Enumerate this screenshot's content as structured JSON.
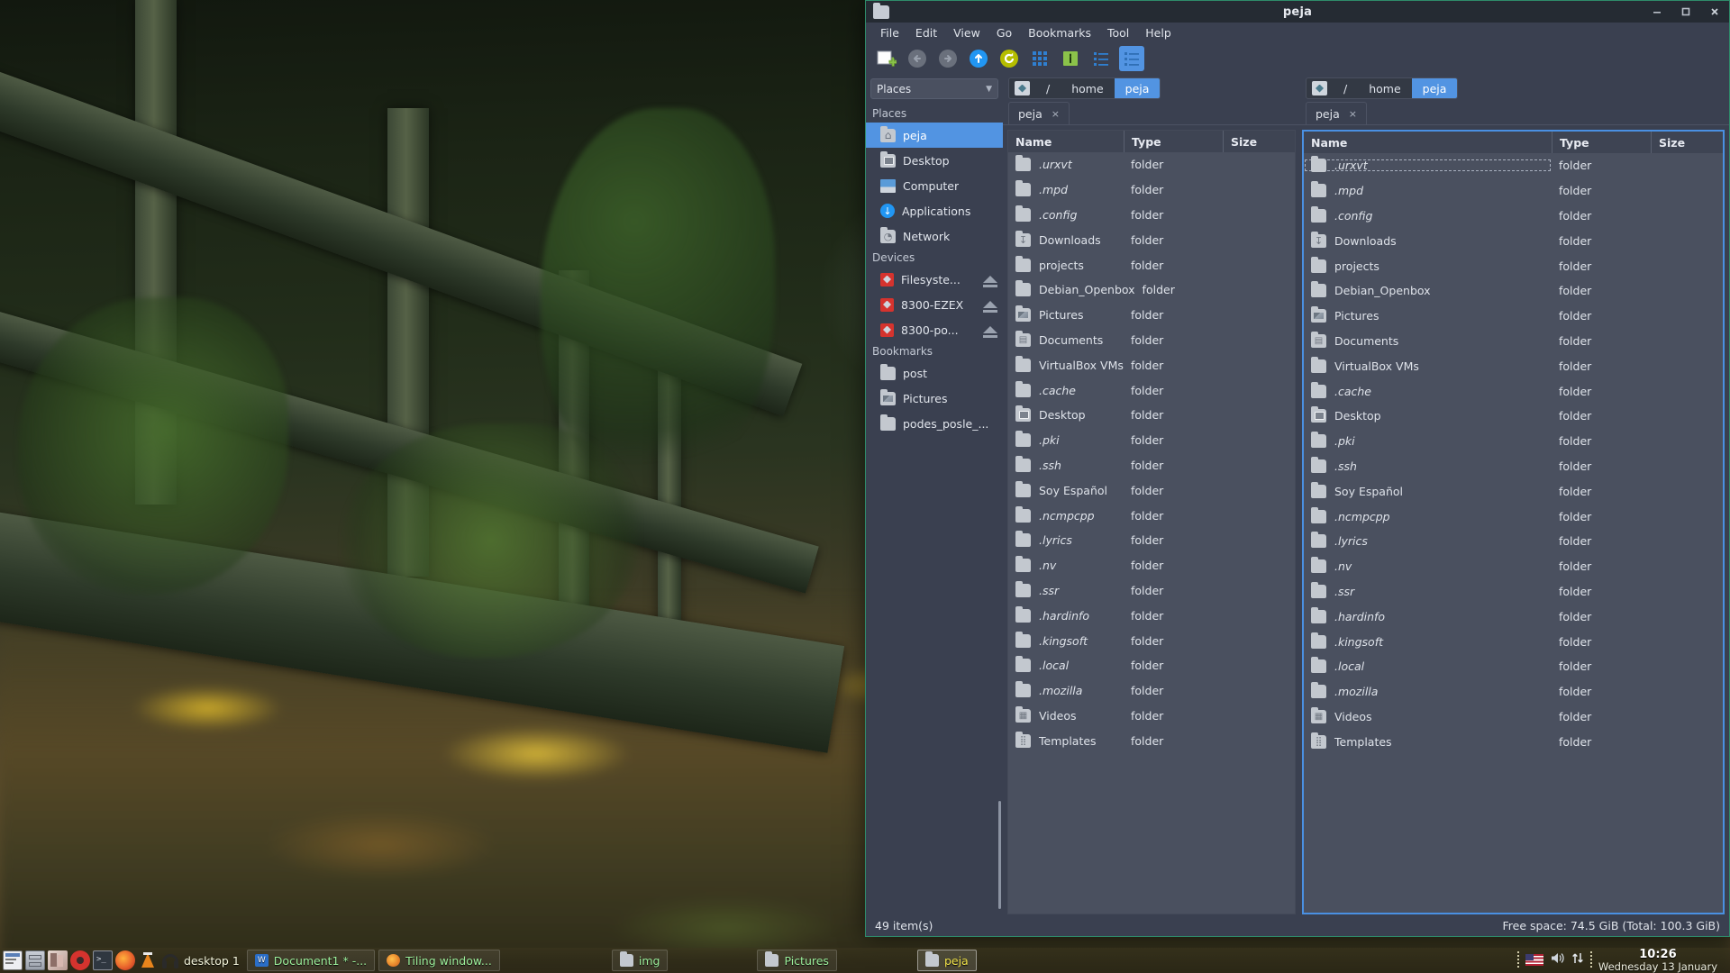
{
  "window": {
    "title": "peja",
    "controls": {
      "minimize": "minimize",
      "maximize": "maximize",
      "close": "close"
    }
  },
  "menubar": [
    "File",
    "Edit",
    "View",
    "Go",
    "Bookmarks",
    "Tool",
    "Help"
  ],
  "toolbar": [
    {
      "name": "new-tab-icon",
      "label": "New Tab"
    },
    {
      "name": "back-icon",
      "label": "Back"
    },
    {
      "name": "forward-icon",
      "label": "Forward"
    },
    {
      "name": "up-icon",
      "label": "Up"
    },
    {
      "name": "reload-icon",
      "label": "Reload"
    },
    {
      "name": "icon-view-icon",
      "label": "Icon View"
    },
    {
      "name": "info-icon",
      "label": "Info"
    },
    {
      "name": "compact-view-icon",
      "label": "Compact View"
    },
    {
      "name": "detailed-list-view-icon",
      "label": "Detailed List View"
    }
  ],
  "sidebar": {
    "combo_value": "Places",
    "groups": [
      {
        "title": "Places",
        "items": [
          {
            "label": "peja",
            "icon": "home-folder-icon",
            "selected": true
          },
          {
            "label": "Desktop",
            "icon": "desktop-folder-icon",
            "selected": false
          },
          {
            "label": "Computer",
            "icon": "computer-icon",
            "selected": false
          },
          {
            "label": "Applications",
            "icon": "applications-icon",
            "selected": false
          },
          {
            "label": "Network",
            "icon": "network-icon",
            "selected": false
          }
        ]
      },
      {
        "title": "Devices",
        "items": [
          {
            "label": "Filesyste...",
            "icon": "drive-icon",
            "eject": true
          },
          {
            "label": "8300-EZEX",
            "icon": "drive-icon",
            "eject": true
          },
          {
            "label": "8300-po...",
            "icon": "drive-icon",
            "eject": true
          }
        ]
      },
      {
        "title": "Bookmarks",
        "items": [
          {
            "label": "post",
            "icon": "folder-icon"
          },
          {
            "label": "Pictures",
            "icon": "pictures-folder-icon"
          },
          {
            "label": "podes_posle_...",
            "icon": "folder-icon"
          }
        ]
      }
    ]
  },
  "panes": {
    "left": {
      "breadcrumbs": [
        "/",
        "home",
        "peja"
      ],
      "current_crumb": "peja",
      "tab": {
        "label": "peja",
        "close": "×"
      }
    },
    "right": {
      "breadcrumbs": [
        "/",
        "home",
        "peja"
      ],
      "current_crumb": "peja",
      "tab": {
        "label": "peja",
        "close": "×"
      },
      "focused": true
    },
    "columns": [
      "Name",
      "Type",
      "Size"
    ],
    "files": [
      {
        "name": ".urxvt",
        "type": "folder",
        "size": "",
        "icon": "folder-icon",
        "hidden": true
      },
      {
        "name": ".mpd",
        "type": "folder",
        "size": "",
        "icon": "folder-icon",
        "hidden": true
      },
      {
        "name": ".config",
        "type": "folder",
        "size": "",
        "icon": "folder-icon",
        "hidden": true
      },
      {
        "name": "Downloads",
        "type": "folder",
        "size": "",
        "icon": "downloads-folder-icon",
        "hidden": false
      },
      {
        "name": "projects",
        "type": "folder",
        "size": "",
        "icon": "folder-icon",
        "hidden": false
      },
      {
        "name": "Debian_Openbox",
        "type": "folder",
        "size": "",
        "icon": "folder-icon",
        "hidden": false
      },
      {
        "name": "Pictures",
        "type": "folder",
        "size": "",
        "icon": "pictures-folder-icon",
        "hidden": false
      },
      {
        "name": "Documents",
        "type": "folder",
        "size": "",
        "icon": "documents-folder-icon",
        "hidden": false
      },
      {
        "name": "VirtualBox VMs",
        "type": "folder",
        "size": "",
        "icon": "folder-icon",
        "hidden": false
      },
      {
        "name": ".cache",
        "type": "folder",
        "size": "",
        "icon": "folder-icon",
        "hidden": true
      },
      {
        "name": "Desktop",
        "type": "folder",
        "size": "",
        "icon": "desktop-folder-icon",
        "hidden": false
      },
      {
        "name": ".pki",
        "type": "folder",
        "size": "",
        "icon": "folder-icon",
        "hidden": true
      },
      {
        "name": ".ssh",
        "type": "folder",
        "size": "",
        "icon": "folder-icon",
        "hidden": true
      },
      {
        "name": "Soy Español",
        "type": "folder",
        "size": "",
        "icon": "folder-icon",
        "hidden": false
      },
      {
        "name": ".ncmpcpp",
        "type": "folder",
        "size": "",
        "icon": "folder-icon",
        "hidden": true
      },
      {
        "name": ".lyrics",
        "type": "folder",
        "size": "",
        "icon": "folder-icon",
        "hidden": true
      },
      {
        "name": ".nv",
        "type": "folder",
        "size": "",
        "icon": "folder-icon",
        "hidden": true
      },
      {
        "name": ".ssr",
        "type": "folder",
        "size": "",
        "icon": "folder-icon",
        "hidden": true
      },
      {
        "name": ".hardinfo",
        "type": "folder",
        "size": "",
        "icon": "folder-icon",
        "hidden": true
      },
      {
        "name": ".kingsoft",
        "type": "folder",
        "size": "",
        "icon": "folder-icon",
        "hidden": true
      },
      {
        "name": ".local",
        "type": "folder",
        "size": "",
        "icon": "folder-icon",
        "hidden": true
      },
      {
        "name": ".mozilla",
        "type": "folder",
        "size": "",
        "icon": "folder-icon",
        "hidden": true
      },
      {
        "name": "Videos",
        "type": "folder",
        "size": "",
        "icon": "videos-folder-icon",
        "hidden": false
      },
      {
        "name": "Templates",
        "type": "folder",
        "size": "",
        "icon": "templates-folder-icon",
        "hidden": false
      }
    ]
  },
  "statusbar": {
    "item_count": "49 item(s)",
    "free_space": "Free space: 74.5 GiB (Total: 100.3 GiB)"
  },
  "taskbar": {
    "launchers": [
      {
        "name": "text-editor-icon",
        "color": "#e8e8ee"
      },
      {
        "name": "archive-manager-icon",
        "color": "#b9bec6"
      },
      {
        "name": "software-center-icon",
        "color": "#d6c2bb"
      },
      {
        "name": "media-player-icon",
        "color": "#d5332e"
      },
      {
        "name": "terminal-icon",
        "color": "#39414d"
      },
      {
        "name": "firefox-icon",
        "color": "#e8622c"
      },
      {
        "name": "vlc-icon",
        "color": "#e8841c"
      },
      {
        "name": "headphones-icon",
        "color": "#2a2a2a"
      }
    ],
    "desktop_label": "desktop 1",
    "tasks": [
      {
        "label": "Document1 * -...",
        "icon": "writer-icon",
        "active": false
      },
      {
        "label": "Tiling window...",
        "icon": "firefox-icon",
        "active": false
      },
      {
        "label": "img",
        "icon": "folder-icon",
        "active": false
      },
      {
        "label": "Pictures",
        "icon": "folder-icon",
        "active": false
      },
      {
        "label": "peja",
        "icon": "folder-icon",
        "active": true
      }
    ],
    "tray": [
      {
        "name": "keyboard-layout-flag-icon",
        "label": "US"
      },
      {
        "name": "volume-icon",
        "label": "Volume"
      },
      {
        "name": "network-icon",
        "label": "Network"
      }
    ],
    "clock": {
      "time": "10:26",
      "date": "Wednesday 13 January"
    }
  },
  "colors": {
    "accent": "#5294e2",
    "window_bg": "#3a4050",
    "list_bg": "#4a505f",
    "titlebar_bg": "#252b33",
    "focus_border": "#4a90e2",
    "window_border": "#2e8b6a",
    "task_text": "#9cf09c",
    "task_active_text": "#f2e34a"
  }
}
